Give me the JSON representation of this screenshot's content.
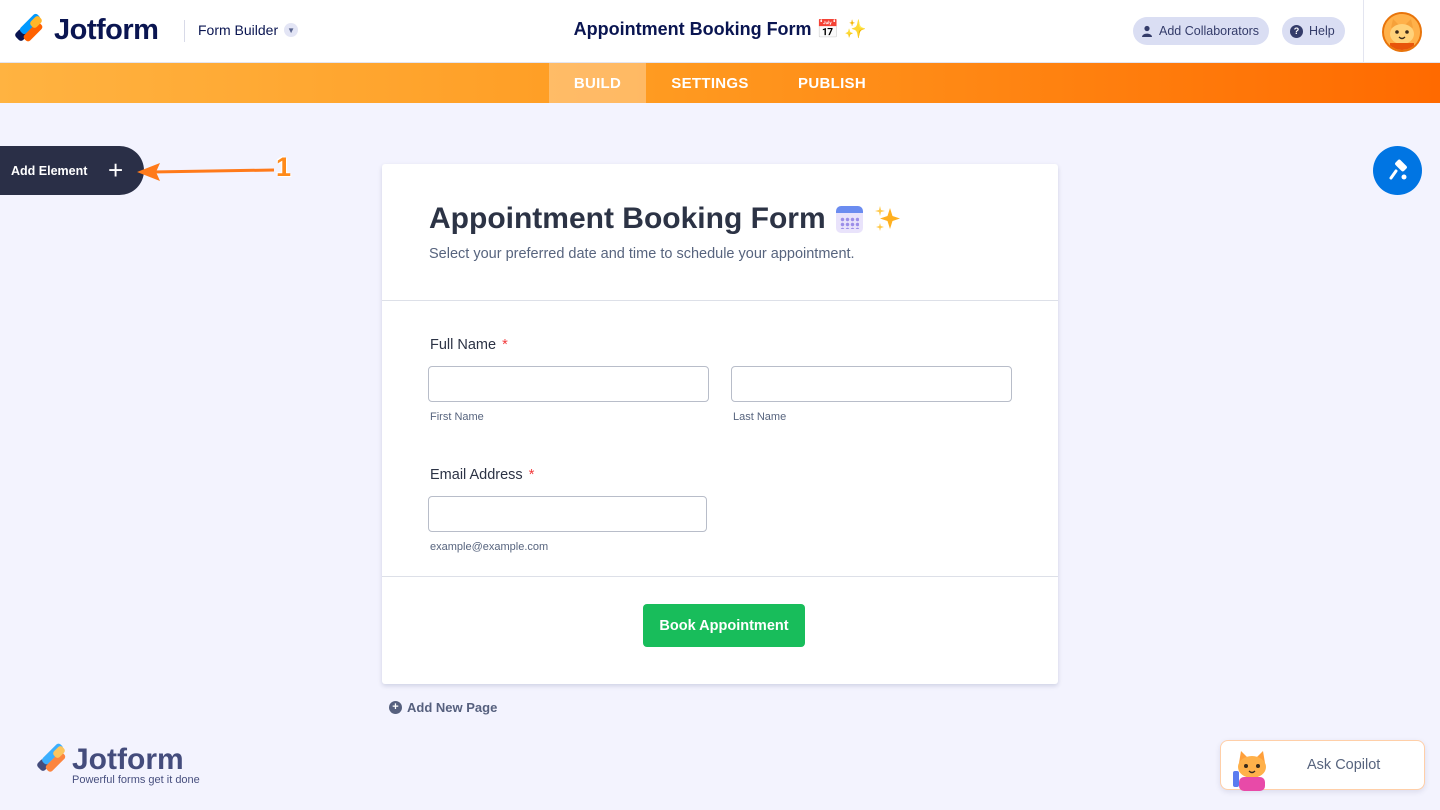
{
  "header": {
    "brand": "Jotform",
    "builder_label": "Form Builder",
    "form_title": "Appointment Booking Form 📅 ✨",
    "collaborators_label": "Add Collaborators",
    "help_label": "Help"
  },
  "nav": {
    "tabs": [
      {
        "label": "BUILD",
        "active": true
      },
      {
        "label": "SETTINGS",
        "active": false
      },
      {
        "label": "PUBLISH",
        "active": false
      }
    ]
  },
  "sidebar": {
    "add_element_label": "Add Element",
    "annotation_number": "1"
  },
  "form": {
    "title": "Appointment Booking Form",
    "subtitle": "Select your preferred date and time to schedule your appointment.",
    "fields": {
      "full_name_label": "Full Name",
      "first_name_sublabel": "First Name",
      "last_name_sublabel": "Last Name",
      "email_label": "Email Address",
      "email_sublabel": "example@example.com",
      "required_mark": "*"
    },
    "submit_label": "Book Appointment"
  },
  "add_page_label": "Add New Page",
  "footer": {
    "brand": "Jotform",
    "tagline": "Powerful forms get it done"
  },
  "copilot_label": "Ask Copilot",
  "colors": {
    "brand_navy": "#0a1551",
    "accent_orange": "#ff6100",
    "submit_green": "#18bd5b",
    "designer_blue": "#0075e3"
  }
}
